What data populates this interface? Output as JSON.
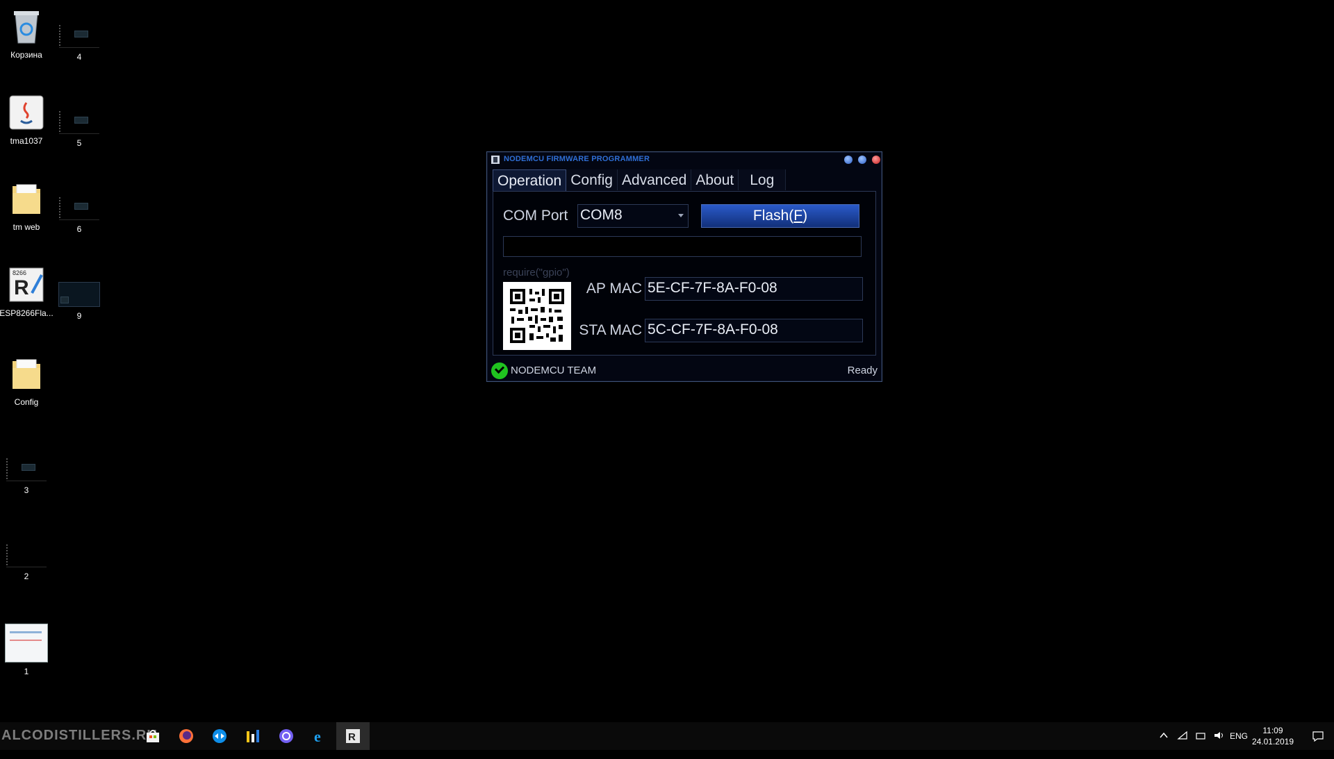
{
  "desktop": {
    "icons": [
      {
        "label": "Корзина"
      },
      {
        "label": "tma1037"
      },
      {
        "label": "tm web"
      },
      {
        "label": "ESP8266Fla..."
      },
      {
        "label": "Config"
      },
      {
        "label": "4"
      },
      {
        "label": "5"
      },
      {
        "label": "6"
      },
      {
        "label": "9"
      },
      {
        "label": "3"
      },
      {
        "label": "2"
      },
      {
        "label": "1"
      }
    ],
    "esp_badge": "8266"
  },
  "window": {
    "title": "NODEMCU FIRMWARE PROGRAMMER",
    "tabs": [
      {
        "label": "Operation",
        "active": true
      },
      {
        "label": "Config"
      },
      {
        "label": "Advanced"
      },
      {
        "label": "About"
      },
      {
        "label": "Log"
      }
    ],
    "operation": {
      "com_port_label": "COM Port",
      "com_port_value": "COM8",
      "flash_label": "Flash(",
      "flash_key": "F",
      "flash_close": ")",
      "hint": "require(\"gpio\")",
      "ap_mac_label": "AP MAC",
      "ap_mac_value": "5E-CF-7F-8A-F0-08",
      "sta_mac_label": "STA MAC",
      "sta_mac_value": "5C-CF-7F-8A-F0-08"
    },
    "status": {
      "left": "NODEMCU TEAM",
      "right": "Ready"
    }
  },
  "taskbar": {
    "watermark": "ALCODISTILLERS.RU",
    "tray": {
      "lang": "ENG",
      "time": "11:09",
      "date": "24.01.2019"
    }
  }
}
